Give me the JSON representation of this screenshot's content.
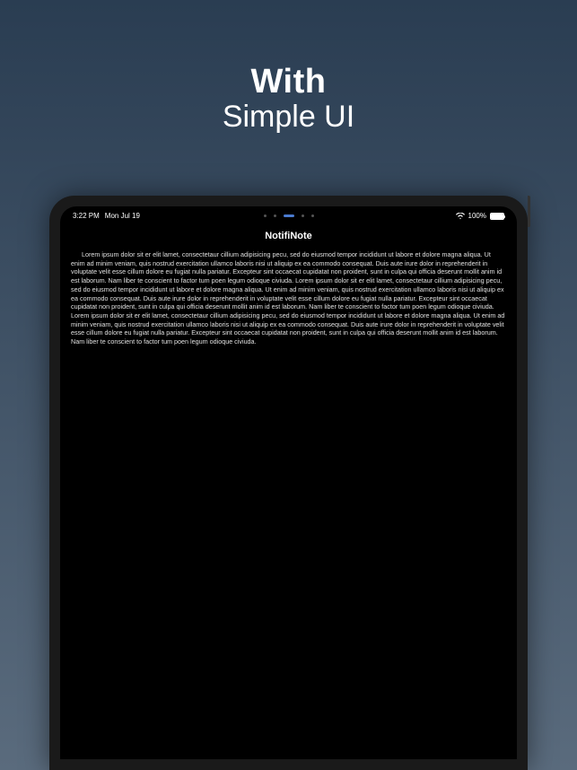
{
  "promo": {
    "title": "With",
    "subtitle": "Simple UI"
  },
  "statusBar": {
    "time": "3:22 PM",
    "date": "Mon Jul 19",
    "battery": "100%"
  },
  "app": {
    "title": "NotifiNote"
  },
  "note": {
    "body": "Lorem ipsum dolor sit er elit lamet, consectetaur cillium adipisicing pecu, sed do eiusmod tempor incididunt ut labore et dolore magna aliqua. Ut enim ad minim veniam, quis nostrud exercitation ullamco laboris nisi ut aliquip ex ea commodo consequat. Duis aute irure dolor in reprehenderit in voluptate velit esse cillum dolore eu fugiat nulla pariatur. Excepteur sint occaecat cupidatat non proident, sunt in culpa qui officia deserunt mollit anim id est laborum. Nam liber te conscient to factor tum poen legum odioque civiuda. Lorem ipsum dolor sit er elit lamet, consectetaur cillium adipisicing pecu, sed do eiusmod tempor incididunt ut labore et dolore magna aliqua. Ut enim ad minim veniam, quis nostrud exercitation ullamco laboris nisi ut aliquip ex ea commodo consequat. Duis aute irure dolor in reprehenderit in voluptate velit esse cillum dolore eu fugiat nulla pariatur. Excepteur sint occaecat cupidatat non proident, sunt in culpa qui officia deserunt mollit anim id est laborum. Nam liber te conscient to factor tum poen legum odioque civiuda. Lorem ipsum dolor sit er elit lamet, consectetaur cillium adipisicing pecu, sed do eiusmod tempor incididunt ut labore et dolore magna aliqua. Ut enim ad minim veniam, quis nostrud exercitation ullamco laboris nisi ut aliquip ex ea commodo consequat. Duis aute irure dolor in reprehenderit in voluptate velit esse cillum dolore eu fugiat nulla pariatur. Excepteur sint occaecat cupidatat non proident, sunt in culpa qui officia deserunt mollit anim id est laborum. Nam liber te conscient to factor tum poen legum odioque civiuda."
  }
}
